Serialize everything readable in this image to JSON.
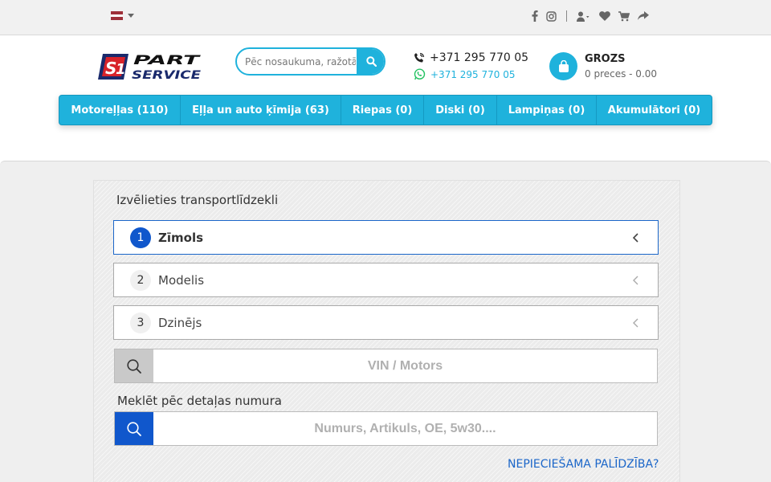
{
  "topbar": {
    "language": "lv",
    "icons": [
      "facebook-icon",
      "instagram-icon",
      "user-icon",
      "heart-icon",
      "cart-icon",
      "share-icon"
    ]
  },
  "header": {
    "logo_text_line1": "PART",
    "logo_text_line2": "SERVICE",
    "search_placeholder": "Pēc nosaukuma, ražotāja",
    "phone_primary": "+371 295 770 05",
    "phone_whatsapp": "+371 295 770 05",
    "cart_title": "GROZS",
    "cart_summary": "0 preces - 0.00"
  },
  "nav": {
    "items": [
      {
        "label": "Motoreļļas (110)"
      },
      {
        "label": "Eļļa un auto ķīmija (63)"
      },
      {
        "label": "Riepas (0)"
      },
      {
        "label": "Diski (0)"
      },
      {
        "label": "Lampiņas (0)"
      },
      {
        "label": "Akumulātori (0)"
      }
    ]
  },
  "vehicle": {
    "title": "Izvēlieties transportlīdzekli",
    "steps": [
      {
        "num": "1",
        "label": "Zīmols"
      },
      {
        "num": "2",
        "label": "Modelis"
      },
      {
        "num": "3",
        "label": "Dzinējs"
      }
    ],
    "vin_placeholder": "VIN / Motors",
    "part_search_label": "Meklēt pēc detaļas numura",
    "part_placeholder": "Numurs, Artikuls, OE, 5w30....",
    "help_link": "NEPIECIEŠAMA PALĪDZĪBA?"
  },
  "colors": {
    "accent": "#1fb2dc",
    "active_blue": "#1057cc",
    "link_blue": "#1b66c9"
  }
}
